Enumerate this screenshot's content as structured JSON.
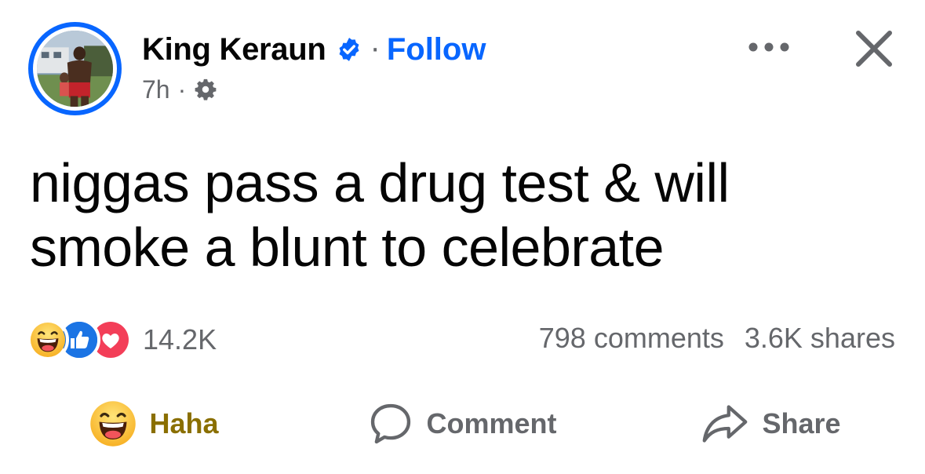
{
  "post": {
    "author_name": "King Keraun",
    "separator": "·",
    "follow_label": "Follow",
    "time": "7h",
    "meta_separator": "·",
    "text": "niggas pass a drug test & will smoke a blunt to celebrate"
  },
  "reactions": {
    "icons": [
      "haha-icon",
      "like-icon",
      "love-icon"
    ],
    "count": "14.2K"
  },
  "stats": {
    "comments": "798 comments",
    "shares": "3.6K shares"
  },
  "actions": {
    "reaction_label": "Haha",
    "comment_label": "Comment",
    "share_label": "Share"
  },
  "colors": {
    "accent": "#0866ff",
    "muted": "#65676b",
    "haha_text": "#8a6f00",
    "love": "#f33e58"
  }
}
